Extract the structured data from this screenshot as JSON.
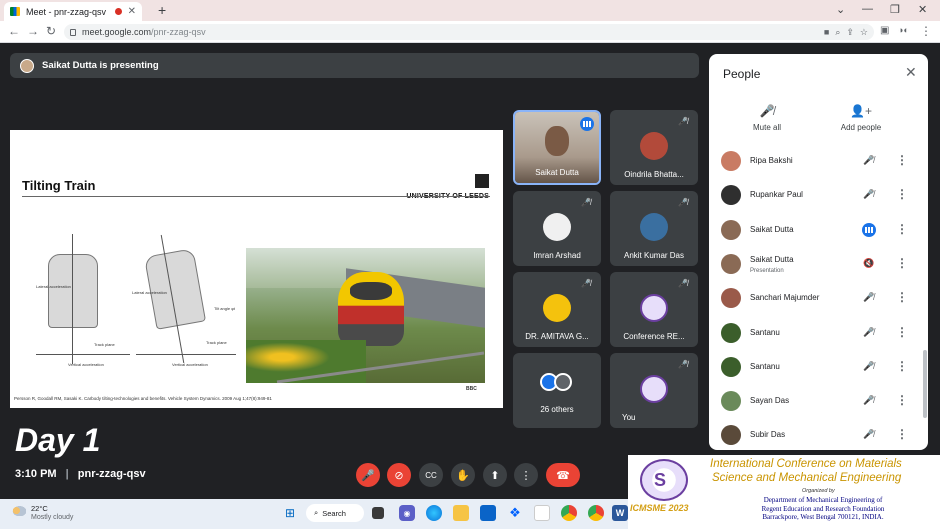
{
  "browser": {
    "tab_title": "Meet - pnr-zzag-qsv",
    "tab_close": "✕",
    "new_tab": "+",
    "url_host": "meet.google.com",
    "url_path": "/pnr-zzag-qsv",
    "window_controls": [
      "⌄",
      "—",
      "❐",
      "✕"
    ]
  },
  "presenting_bar": {
    "text": "Saikat Dutta is presenting"
  },
  "slide": {
    "title": "Tilting Train",
    "university": "UNIVERSITY OF LEEDS",
    "diagram_labels": [
      "Lateral acceleration",
      "Track plane",
      "Vertical acceleration",
      "Tilt angle φt"
    ],
    "citation": "Persson R, Goodall RM, Sasaki K. Carbody tilting-technologies and benefits. Vehicle System Dynamics. 2009 Aug 1;47(8):949-81",
    "photo_credit": "BBC"
  },
  "tiles": [
    {
      "name": "Saikat Dutta",
      "speaking": true,
      "avatar_color": "#8a6a55",
      "video": true
    },
    {
      "name": "Oindrila Bhatta...",
      "avatar_color": "#b24a3a"
    },
    {
      "name": "Imran Arshad",
      "avatar_color": "#f0f0f0"
    },
    {
      "name": "Ankit Kumar Das",
      "avatar_color": "#3a6fa0"
    },
    {
      "name": "DR. AMITAVA G...",
      "avatar_color": "#f4c20d"
    },
    {
      "name": "Conference RE...",
      "avatar_color": "#e7defa"
    },
    {
      "name": "26 others",
      "avatar_color": "#5f6368"
    },
    {
      "name": "You",
      "avatar_color": "#e7defa"
    }
  ],
  "overlay": {
    "day_label": "Day 1",
    "time": "3:10 PM",
    "separator": "|",
    "meeting_code": "pnr-zzag-qsv"
  },
  "controls": {
    "mic": "🎤",
    "camera": "⊘",
    "captions": "CC",
    "raise_hand": "✋",
    "present": "⬆",
    "more": "⋮",
    "end_call": "☎"
  },
  "people_panel": {
    "title": "People",
    "close": "✕",
    "mute_all": "Mute all",
    "add_people": "Add people",
    "participants": [
      {
        "name": "Ripa Bakshi",
        "avatar_color": "#c97b63",
        "mic": "muted"
      },
      {
        "name": "Rupankar Paul",
        "avatar_color": "#2f2f2f",
        "mic": "muted"
      },
      {
        "name": "Saikat Dutta",
        "avatar_color": "#8a6a55",
        "mic": "speaking"
      },
      {
        "name": "Saikat Dutta",
        "sub": "Presentation",
        "avatar_color": "#8a6a55",
        "mic": "presenting"
      },
      {
        "name": "Sanchari Majumder",
        "avatar_color": "#9a5a4a",
        "mic": "muted"
      },
      {
        "name": "Santanu",
        "avatar_color": "#3b5e2b",
        "mic": "muted"
      },
      {
        "name": "Santanu",
        "avatar_color": "#3b5e2b",
        "mic": "muted"
      },
      {
        "name": "Sayan Das",
        "avatar_color": "#6a8a5a",
        "mic": "muted"
      },
      {
        "name": "Subir Das",
        "avatar_color": "#5a4a3a",
        "mic": "muted"
      }
    ]
  },
  "banner": {
    "title_line1": "International Conference on Materials",
    "title_line2": "Science and Mechanical Engineering",
    "organized_by": "Organized by",
    "dept_line1": "Department of Mechanical Engineering of",
    "dept_line2": "Regent Education and Research Foundation",
    "dept_line3": "Barrackpore, West Bengal 700121, INDIA.",
    "year_label": "ICMSME 2023"
  },
  "taskbar": {
    "temperature": "22°C",
    "condition": "Mostly cloudy",
    "search": "Search"
  },
  "colors": {
    "meet_bg": "#202124",
    "tile_bg": "#3c4043",
    "end_call": "#ea4335",
    "speaking_blue": "#1a73e8"
  }
}
